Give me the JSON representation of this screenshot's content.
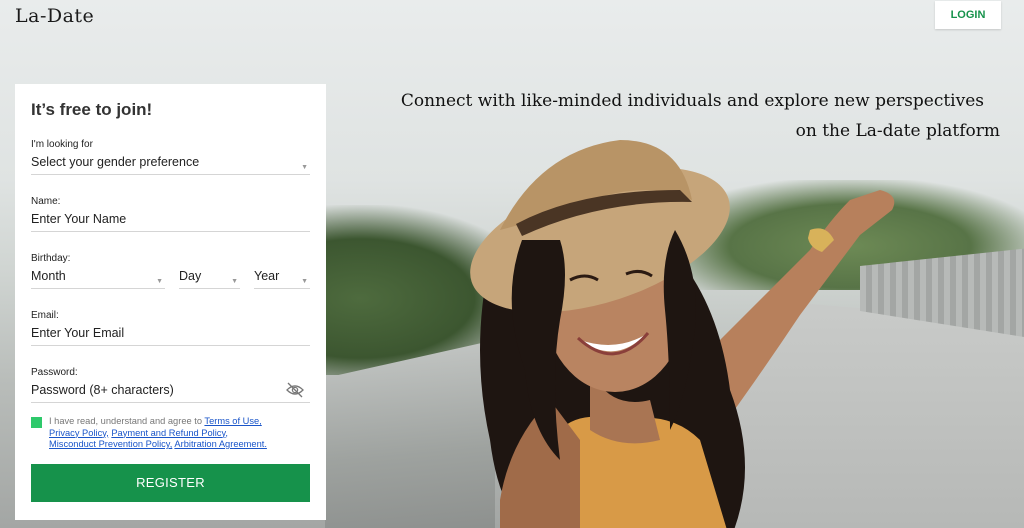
{
  "brand": {
    "logo_text": "La-Date"
  },
  "header": {
    "login_label": "LOGIN"
  },
  "hero": {
    "tagline_line1": "Connect with like-minded individuals and explore new perspectives",
    "tagline_line2": "on the La-date platform"
  },
  "form": {
    "title": "It’s free to join!",
    "looking_for": {
      "label": "I'm looking for",
      "value": "Select your gender preference"
    },
    "name": {
      "label": "Name:",
      "placeholder": "Enter Your Name"
    },
    "birthday": {
      "label": "Birthday:",
      "month": "Month",
      "day": "Day",
      "year": "Year"
    },
    "email": {
      "label": "Email:",
      "placeholder": "Enter Your Email"
    },
    "password": {
      "label": "Password:",
      "placeholder": "Password (8+ characters)"
    },
    "agree": {
      "prefix": "I have read, understand and agree to",
      "terms": "Terms of Use,",
      "privacy": "Privacy Policy,",
      "refund": "Payment and Refund Policy,",
      "misconduct": "Misconduct Prevention Policy,",
      "arbitration": "Arbitration Agreement."
    },
    "register_label": "REGISTER"
  },
  "colors": {
    "accent_green": "#16924b",
    "checkbox_green": "#2ec96b",
    "link_blue": "#1a55c9"
  }
}
